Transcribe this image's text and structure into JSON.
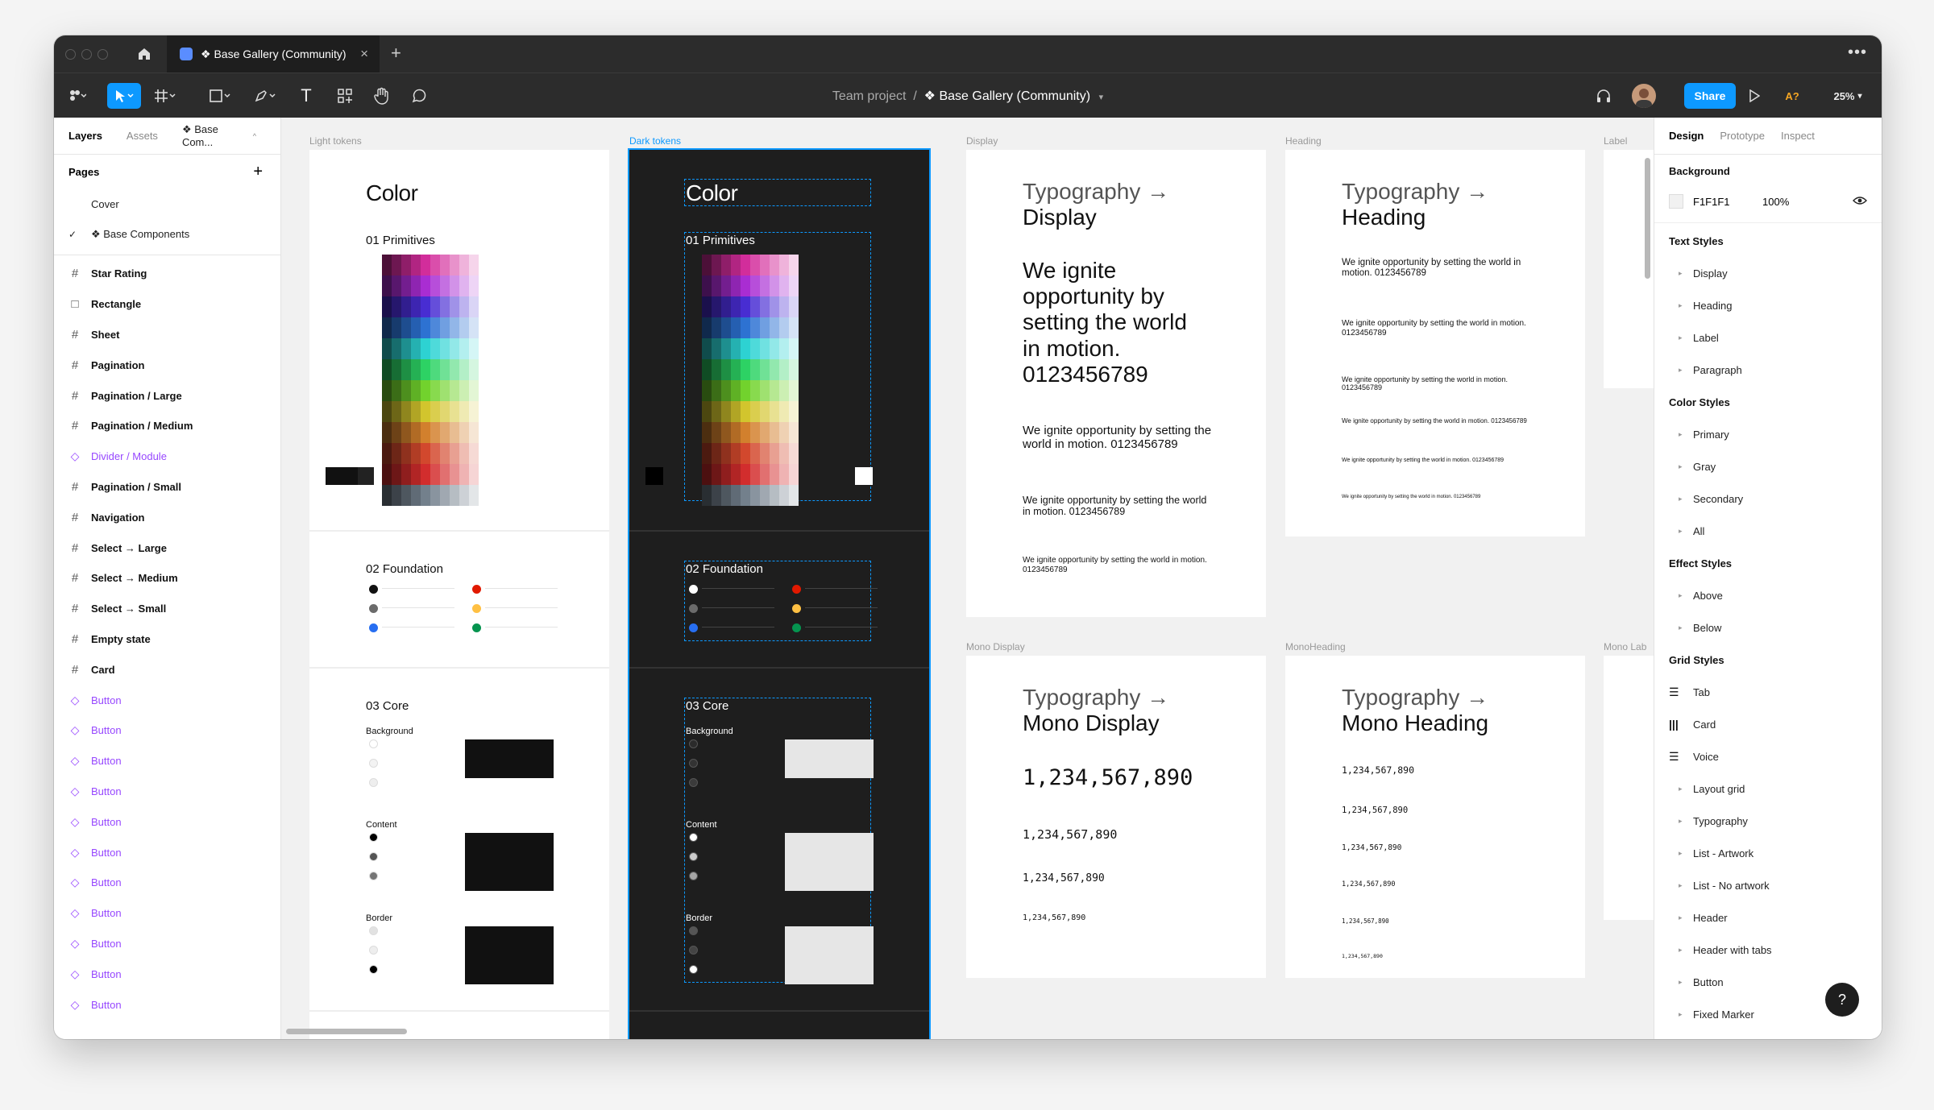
{
  "window": {
    "tab_title": "❖ Base Gallery (Community)",
    "tab_close": "×",
    "new_tab": "+",
    "more": "•••"
  },
  "toolbar": {
    "breadcrumb_team": "Team project",
    "breadcrumb_sep": "/",
    "breadcrumb_file": "❖ Base Gallery (Community)",
    "share_label": "Share",
    "avatar_initials": "",
    "ai_label": "A?",
    "zoom": "25%",
    "colors": {
      "accent": "#0d99ff",
      "bg": "#2c2c2c"
    }
  },
  "left_panel": {
    "tabs": [
      "Layers",
      "Assets",
      "❖ Base Com..."
    ],
    "pages_label": "Pages",
    "pages": [
      "Cover",
      "❖ Base Components"
    ],
    "layers": [
      {
        "label": "Star Rating",
        "icon": "frame"
      },
      {
        "label": "Rectangle",
        "icon": "rect"
      },
      {
        "label": "Sheet",
        "icon": "frame"
      },
      {
        "label": "Pagination",
        "icon": "frame"
      },
      {
        "label": "Pagination / Large",
        "icon": "frame"
      },
      {
        "label": "Pagination / Medium",
        "icon": "frame"
      },
      {
        "label": "Divider / Module",
        "icon": "component"
      },
      {
        "label": "Pagination / Small",
        "icon": "frame"
      },
      {
        "label": "Navigation",
        "icon": "frame"
      },
      {
        "label": "Select → Large",
        "icon": "frame"
      },
      {
        "label": "Select → Medium",
        "icon": "frame"
      },
      {
        "label": "Select → Small",
        "icon": "frame"
      },
      {
        "label": "Empty state",
        "icon": "frame"
      },
      {
        "label": "Card",
        "icon": "frame"
      },
      {
        "label": "Button",
        "icon": "component"
      },
      {
        "label": "Button",
        "icon": "component"
      },
      {
        "label": "Button",
        "icon": "component"
      },
      {
        "label": "Button",
        "icon": "component"
      },
      {
        "label": "Button",
        "icon": "component"
      },
      {
        "label": "Button",
        "icon": "component"
      },
      {
        "label": "Button",
        "icon": "component"
      },
      {
        "label": "Button",
        "icon": "component"
      },
      {
        "label": "Button",
        "icon": "component"
      },
      {
        "label": "Button",
        "icon": "component"
      },
      {
        "label": "Button",
        "icon": "component"
      }
    ]
  },
  "canvas": {
    "frame_labels": [
      "Light tokens",
      "Dark tokens",
      "Display",
      "Heading",
      "Label",
      "Mono Display",
      "MonoHeading",
      "Mono Lab"
    ],
    "color_title": "Color",
    "primitives": "01 Primitives",
    "foundation": "02 Foundation",
    "core": "03 Core",
    "core_sections": [
      "Background",
      "Content",
      "Border"
    ],
    "typo_display_title": "Typography →",
    "typo_display_sub": "Display",
    "typo_heading_sub": "Heading",
    "typo_mono_display_sub": "Mono Display",
    "typo_mono_heading_sub": "Mono Heading",
    "sample_text": "We ignite opportunity by setting the world in motion. 0123456789",
    "mono_number": "1,234,567,890"
  },
  "right_panel": {
    "tabs": [
      "Design",
      "Prototype",
      "Inspect"
    ],
    "background_label": "Background",
    "background_hex": "F1F1F1",
    "background_opacity": "100%",
    "text_styles_label": "Text Styles",
    "text_styles": [
      "Display",
      "Heading",
      "Label",
      "Paragraph"
    ],
    "color_styles_label": "Color Styles",
    "color_styles": [
      "Primary",
      "Gray",
      "Secondary",
      "All"
    ],
    "effect_styles_label": "Effect Styles",
    "effect_styles": [
      "Above",
      "Below"
    ],
    "grid_styles_label": "Grid Styles",
    "grid_styles": [
      {
        "label": "Tab",
        "icon": "rows"
      },
      {
        "label": "Card",
        "icon": "columns"
      },
      {
        "label": "Voice",
        "icon": "rows"
      },
      {
        "label": "Layout grid",
        "icon": "folder"
      },
      {
        "label": "Typography",
        "icon": "folder"
      },
      {
        "label": "List - Artwork",
        "icon": "folder"
      },
      {
        "label": "List - No artwork",
        "icon": "folder"
      },
      {
        "label": "Header",
        "icon": "folder"
      },
      {
        "label": "Header with tabs",
        "icon": "folder"
      },
      {
        "label": "Button",
        "icon": "folder"
      },
      {
        "label": "Fixed Marker",
        "icon": "folder"
      }
    ],
    "help": "?"
  }
}
